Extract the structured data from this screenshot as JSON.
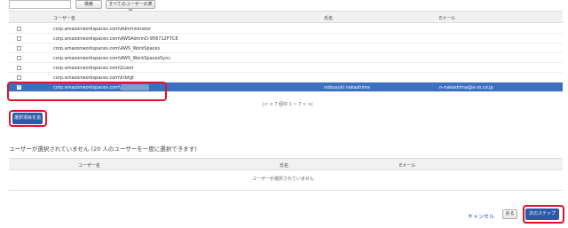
{
  "toolbar": {
    "search_value": "",
    "search_label": "検索",
    "show_all_label": "すべてのユーザーの表示"
  },
  "available_table": {
    "headers": [
      "ユーザー名",
      "氏名",
      "Eメール"
    ],
    "rows": [
      {
        "username": "corp.amazonworkspaces.com\\Administrator",
        "name": "",
        "email": "",
        "checked": false
      },
      {
        "username": "corp.amazonworkspaces.com\\AWSAdminD-956712F7C8",
        "name": "",
        "email": "",
        "checked": false
      },
      {
        "username": "corp.amazonworkspaces.com\\AWS_WorkSpaces",
        "name": "",
        "email": "",
        "checked": false
      },
      {
        "username": "corp.amazonworkspaces.com\\AWS_WorkSpacesSync",
        "name": "",
        "email": "",
        "checked": false
      },
      {
        "username": "corp.amazonworkspaces.com\\Guest",
        "name": "",
        "email": "",
        "checked": false
      },
      {
        "username": "corp.amazonworkspaces.com\\krbtgt",
        "name": "",
        "email": "",
        "checked": false
      },
      {
        "username": "corp.amazonworkspaces.com\\",
        "name": "nobuyuki nakashima",
        "email": "n-nakashima@a-zs.co.jp",
        "checked": true
      }
    ],
    "pager": "|<  <  7 個中 1 ~ 7  >  >|"
  },
  "add_button_label": "選択項目を追加",
  "selected_section": {
    "title": "ユーザーが選択されていません (20 人のユーザーを一度に選択できます)",
    "headers": [
      "ユーザー名",
      "氏名",
      "Eメール"
    ],
    "empty_text": "ユーザーが選択されていません"
  },
  "footer": {
    "cancel_label": "キャンセル",
    "back_label": "戻る",
    "next_label": "次のステップ"
  },
  "colors": {
    "selected_row": "#3b6fc1",
    "primary_button": "#2a5aa8",
    "highlight": "#e3102a"
  }
}
